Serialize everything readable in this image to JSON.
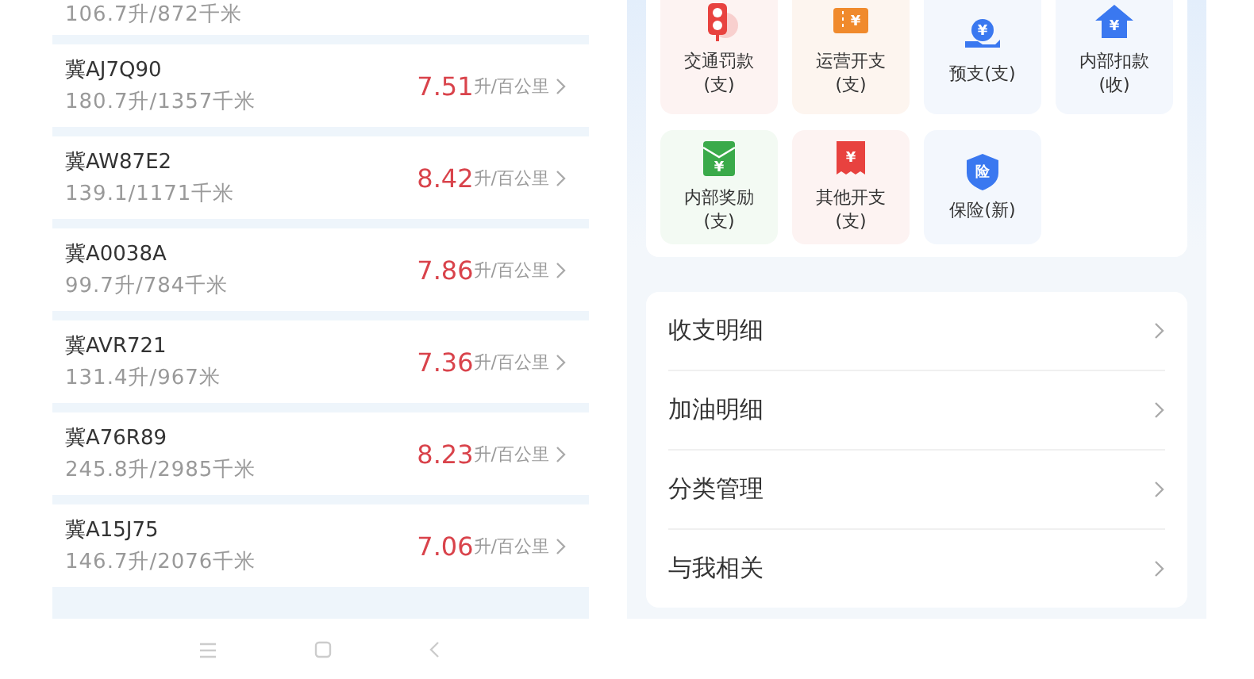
{
  "vehicles": {
    "partial_first": {
      "distance": "106.7升/872千米"
    },
    "rows": [
      {
        "plate": "冀AJ7Q90",
        "distance": "180.7升/1357千米",
        "consumption": "7.51",
        "unit": "升/百公里"
      },
      {
        "plate": "冀AW87E2",
        "distance": "139.1/1171千米",
        "consumption": "8.42",
        "unit": "升/百公里"
      },
      {
        "plate": "冀A0038A",
        "distance": "99.7升/784千米",
        "consumption": "7.86",
        "unit": "升/百公里"
      },
      {
        "plate": "冀AVR721",
        "distance": "131.4升/967米",
        "consumption": "7.36",
        "unit": "升/百公里"
      },
      {
        "plate": "冀A76R89",
        "distance": "245.8升/2985千米",
        "consumption": "8.23",
        "unit": "升/百公里"
      },
      {
        "plate": "冀A15J75",
        "distance": "146.7升/2076千米",
        "consumption": "7.06",
        "unit": "升/百公里"
      }
    ]
  },
  "tiles": [
    {
      "label": "交通罚款(支)",
      "kind": "traffic-light",
      "color": "#e8423f"
    },
    {
      "label": "运营开支(支)",
      "kind": "ticket",
      "color": "#f08a2c",
      "icon_text": "¥"
    },
    {
      "label": "预支(支)",
      "kind": "hand-coin",
      "color": "#3a78f0",
      "icon_text": "¥"
    },
    {
      "label": "内部扣款(收)",
      "kind": "house",
      "color": "#3a78f0",
      "icon_text": "¥"
    },
    {
      "label": "内部奖励(支)",
      "kind": "envelope",
      "color": "#3aaa4a",
      "icon_text": "¥"
    },
    {
      "label": "其他开支(支)",
      "kind": "receipt",
      "color": "#e8423f",
      "icon_text": "¥"
    },
    {
      "label": "保险(新)",
      "kind": "shield",
      "color": "#3a78f0",
      "icon_text": "险"
    }
  ],
  "menu": [
    {
      "label": "收支明细"
    },
    {
      "label": "加油明细"
    },
    {
      "label": "分类管理"
    },
    {
      "label": "与我相关"
    }
  ]
}
